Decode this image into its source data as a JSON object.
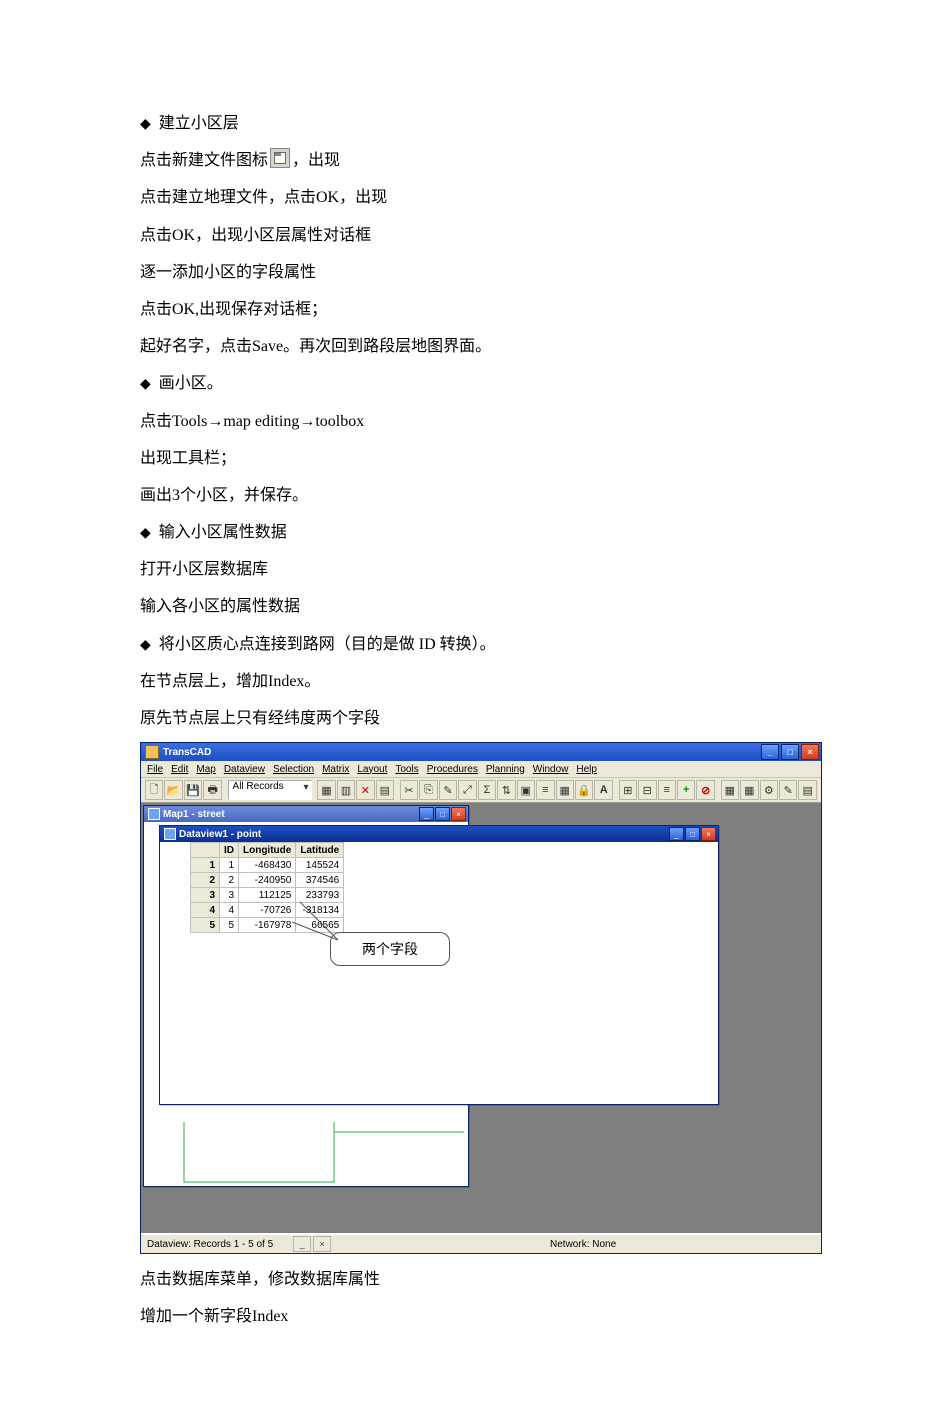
{
  "doc": {
    "b1": "建立小区层",
    "l2a": "点击新建文件图标",
    "l2b": "，出现",
    "l3": "点击建立地理文件，点击OK，出现",
    "l4": "点击OK，出现小区层属性对话框",
    "l5": "逐一添加小区的字段属性",
    "l6": "点击OK,出现保存对话框；",
    "l7": "起好名字，点击Save。再次回到路段层地图界面。",
    "b2": "画小区。",
    "l9": "点击Tools→map editing→toolbox",
    "l10": "出现工具栏；",
    "l11": "画出3个小区，并保存。",
    "b3": "输入小区属性数据",
    "l13": "打开小区层数据库",
    "l14": "输入各小区的属性数据",
    "b4": "将小区质心点连接到路网（目的是做 ID 转换）。",
    "l16": "在节点层上，增加Index。",
    "l17": "原先节点层上只有经纬度两个字段",
    "l18": "点击数据库菜单，修改数据库属性",
    "l19": "增加一个新字段Index"
  },
  "app": {
    "title": "TransCAD",
    "menus": [
      "File",
      "Edit",
      "Map",
      "Dataview",
      "Selection",
      "Matrix",
      "Layout",
      "Tools",
      "Procedures",
      "Planning",
      "Window",
      "Help"
    ],
    "dropdown": "All Records",
    "map_window_title": "Map1 - street",
    "dataview_title": "Dataview1 - point",
    "callout": "两个字段",
    "status_left": "Dataview: Records 1 - 5 of 5",
    "status_right": "Network: None",
    "table": {
      "headers": [
        "ID",
        "Longitude",
        "Latitude"
      ],
      "rows": [
        [
          1,
          -468430,
          145524
        ],
        [
          2,
          -240950,
          374546
        ],
        [
          3,
          112125,
          233793
        ],
        [
          4,
          -70726,
          -318134
        ],
        [
          5,
          -167978,
          66565
        ]
      ]
    }
  }
}
